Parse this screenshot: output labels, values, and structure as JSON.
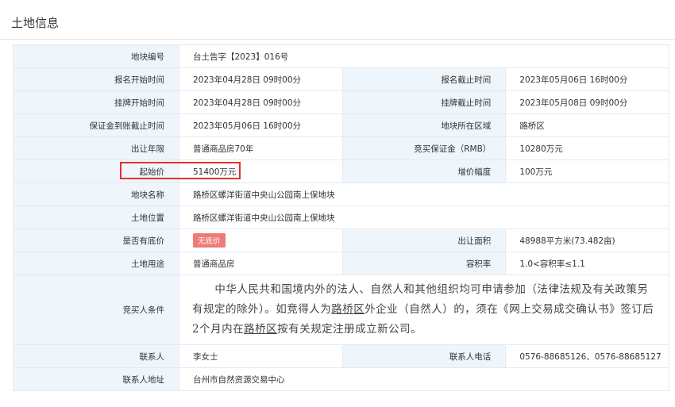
{
  "panel": {
    "title": "土地信息"
  },
  "rows": {
    "code": {
      "label": "地块编号",
      "value": "台土告字【2023】016号"
    },
    "signup_start": {
      "label": "报名开始时间",
      "value": "2023年04月28日 09时00分"
    },
    "signup_end": {
      "label": "报名截止时间",
      "value": "2023年05月06日 16时00分"
    },
    "listing_start": {
      "label": "挂牌开始时间",
      "value": "2023年04月28日 09时00分"
    },
    "listing_end": {
      "label": "挂牌截止时间",
      "value": "2023年05月08日 09时00分"
    },
    "deposit_deadline": {
      "label": "保证金到账截止时间",
      "value": "2023年05月06日 16时00分"
    },
    "district": {
      "label": "地块所在区域",
      "value": "路桥区"
    },
    "term": {
      "label": "出让年限",
      "value": "普通商品房70年"
    },
    "deposit": {
      "label": "竞买保证金（RMB）",
      "value": "10280万元"
    },
    "start_price": {
      "label": "起始价",
      "value": "51400万元"
    },
    "increment": {
      "label": "增价幅度",
      "value": "100万元"
    },
    "name": {
      "label": "地块名称",
      "value": "路桥区螺洋街道中央山公园南上保地块"
    },
    "location": {
      "label": "土地位置",
      "value": "路桥区螺洋街道中央山公园南上保地块"
    },
    "reserve": {
      "label": "是否有底价",
      "value": "无底价"
    },
    "area": {
      "label": "出让面积",
      "value": "48988平方米(73.482亩)"
    },
    "usage": {
      "label": "土地用途",
      "value": "普通商品房"
    },
    "far": {
      "label": "容积率",
      "value": "1.0<容积率≤1.1"
    },
    "conditions": {
      "label": "竞买人条件",
      "part1": "中华人民共和国境内外的法人、自然人和其他组织均可申请参加（法律法规及有关政策另有规定的除外）。如竞得人为",
      "link1": "路桥区",
      "part2": "外企业（自然人）的，须在《网上交易成交确认书》签订后2个月内在",
      "link2": "路桥区",
      "part3": "按有关规定注册成立新公司。"
    },
    "contact": {
      "label": "联系人",
      "value": "李女士"
    },
    "phone": {
      "label": "联系人电话",
      "value": "0576-88685126、0576-88685127"
    },
    "address": {
      "label": "联系人地址",
      "value": "台州市自然资源交易中心"
    }
  },
  "colors": {
    "label_bg": "#eef5fb",
    "border": "#e5e9ee",
    "badge": "#ef7a76",
    "highlight": "#e4312b"
  }
}
